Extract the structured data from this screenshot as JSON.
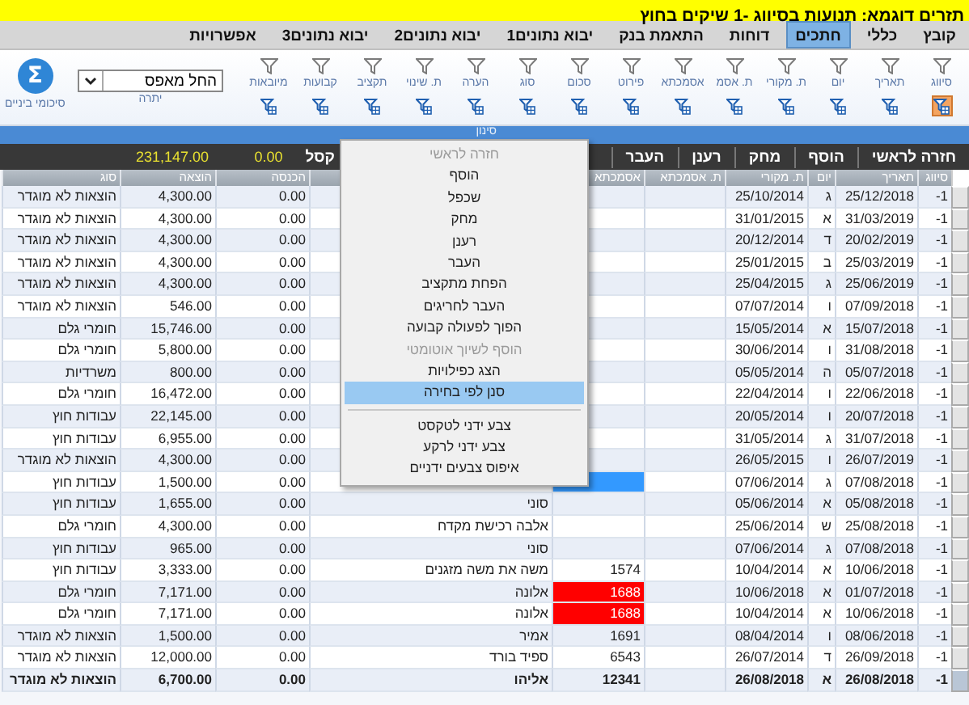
{
  "window": {
    "title": "תזרים דוגמא: תנועות בסיווג -1 שיקים בחוץ"
  },
  "menu_bar": {
    "tabs": [
      {
        "label": "קובץ",
        "selected": false
      },
      {
        "label": "כללי",
        "selected": false
      },
      {
        "label": "חתכים",
        "selected": true
      },
      {
        "label": "דוחות",
        "selected": false
      },
      {
        "label": "התאמת בנק",
        "selected": false
      },
      {
        "label": "יבוא נתונים1",
        "selected": false
      },
      {
        "label": "יבוא נתונים2",
        "selected": false
      },
      {
        "label": "יבוא נתונים3",
        "selected": false
      },
      {
        "label": "אפשרויות",
        "selected": false
      }
    ]
  },
  "toolbar": {
    "filters": [
      {
        "label": "סיווג",
        "active": true
      },
      {
        "label": "תאריך",
        "active": false
      },
      {
        "label": "יום",
        "active": false
      },
      {
        "label": "ת. מקורי",
        "active": false
      },
      {
        "label": "ת. אסמ",
        "active": false
      },
      {
        "label": "אסמכתא",
        "active": false
      },
      {
        "label": "פירוט",
        "active": false
      },
      {
        "label": "סכום",
        "active": false
      },
      {
        "label": "סוג",
        "active": false
      },
      {
        "label": "הערה",
        "active": false
      },
      {
        "label": "ת. שינוי",
        "active": false
      },
      {
        "label": "תקציב",
        "active": false
      },
      {
        "label": "קבועות",
        "active": false
      },
      {
        "label": "מיובאות",
        "active": false
      }
    ],
    "balance": {
      "value": "החל מאפס",
      "label": "יתרה"
    },
    "subtotals": {
      "icon": "Σ",
      "label": "סיכומי ביניים"
    }
  },
  "filter_strip": {
    "label": "סינון"
  },
  "action_bar": {
    "buttons": [
      "חזרה לראשי",
      "הוסף",
      "מחק",
      "רענן",
      "העבר"
    ],
    "export_label": "קסל",
    "income_total": "0.00",
    "expense_total": "231,147.00"
  },
  "table": {
    "columns": [
      "סיווג",
      "תאריך",
      "יום",
      "ת. מקורי",
      "ת. אסמכתא",
      "אסמכתא",
      null,
      "הכנסה",
      "הוצאה",
      "סוג"
    ],
    "rows": [
      {
        "classification": "-1",
        "date": "25/12/2018",
        "day": "ג",
        "original_date": "25/10/2014",
        "income": "0.00",
        "expense": "4,300.00",
        "type": "הוצאות לא מוגדר",
        "selected": false
      },
      {
        "classification": "-1",
        "date": "31/03/2019",
        "day": "א",
        "original_date": "31/01/2015",
        "income": "0.00",
        "expense": "4,300.00",
        "type": "הוצאות לא מוגדר",
        "selected": false
      },
      {
        "classification": "-1",
        "date": "20/02/2019",
        "day": "ד",
        "original_date": "20/12/2014",
        "income": "0.00",
        "expense": "4,300.00",
        "type": "הוצאות לא מוגדר",
        "selected": false
      },
      {
        "classification": "-1",
        "date": "25/03/2019",
        "day": "ב",
        "original_date": "25/01/2015",
        "income": "0.00",
        "expense": "4,300.00",
        "type": "הוצאות לא מוגדר",
        "selected": false
      },
      {
        "classification": "-1",
        "date": "25/06/2019",
        "day": "ג",
        "original_date": "25/04/2015",
        "income": "0.00",
        "expense": "4,300.00",
        "type": "הוצאות לא מוגדר",
        "selected": false
      },
      {
        "classification": "-1",
        "date": "07/09/2018",
        "day": "ו",
        "original_date": "07/07/2014",
        "income": "0.00",
        "expense": "546.00",
        "type": "הוצאות לא מוגדר",
        "selected": false
      },
      {
        "classification": "-1",
        "date": "15/07/2018",
        "day": "א",
        "original_date": "15/05/2014",
        "income": "0.00",
        "expense": "15,746.00",
        "type": "חומרי גלם",
        "selected": false
      },
      {
        "classification": "-1",
        "date": "31/08/2018",
        "day": "ו",
        "original_date": "30/06/2014",
        "income": "0.00",
        "expense": "5,800.00",
        "type": "חומרי גלם",
        "selected": false
      },
      {
        "classification": "-1",
        "date": "05/07/2018",
        "day": "ה",
        "original_date": "05/05/2014",
        "income": "0.00",
        "expense": "800.00",
        "type": "משרדיות",
        "selected": false
      },
      {
        "classification": "-1",
        "date": "22/06/2018",
        "day": "ו",
        "original_date": "22/04/2014",
        "income": "0.00",
        "expense": "16,472.00",
        "type": "חומרי גלם",
        "selected": false
      },
      {
        "classification": "-1",
        "date": "20/07/2018",
        "day": "ו",
        "original_date": "20/05/2014",
        "income": "0.00",
        "expense": "22,145.00",
        "type": "עבודות חוץ",
        "selected": false
      },
      {
        "classification": "-1",
        "date": "31/07/2018",
        "day": "ג",
        "original_date": "31/05/2014",
        "income": "0.00",
        "expense": "6,955.00",
        "type": "עבודות חוץ",
        "selected": false
      },
      {
        "classification": "-1",
        "date": "26/07/2019",
        "day": "ו",
        "original_date": "26/05/2015",
        "income": "0.00",
        "expense": "4,300.00",
        "type": "הוצאות לא מוגדר",
        "selected": false
      },
      {
        "classification": "-1",
        "date": "07/08/2018",
        "day": "ג",
        "original_date": "07/06/2014",
        "color": "#3399ff",
        "income": "0.00",
        "expense": "1,500.00",
        "type": "עבודות חוץ",
        "selected": false
      },
      {
        "classification": "-1",
        "date": "05/08/2018",
        "day": "א",
        "original_date": "05/06/2014",
        "details": "סוני",
        "income": "0.00",
        "expense": "1,655.00",
        "type": "עבודות חוץ",
        "selected": false
      },
      {
        "classification": "-1",
        "date": "25/08/2018",
        "day": "ש",
        "original_date": "25/06/2014",
        "details": "אלבה רכישת מקדח",
        "income": "0.00",
        "expense": "4,300.00",
        "type": "חומרי גלם",
        "selected": false
      },
      {
        "classification": "-1",
        "date": "07/08/2018",
        "day": "ג",
        "original_date": "07/06/2014",
        "details": "סוני",
        "income": "0.00",
        "expense": "965.00",
        "type": "עבודות חוץ",
        "selected": false
      },
      {
        "classification": "-1",
        "date": "10/06/2018",
        "day": "א",
        "original_date": "10/04/2014",
        "reference": "1574",
        "details": "משה את משה מזגנים",
        "income": "0.00",
        "expense": "3,333.00",
        "type": "עבודות חוץ",
        "selected": false
      },
      {
        "classification": "-1",
        "date": "01/07/2018",
        "day": "א",
        "original_date": "10/06/2018",
        "reference": "1688",
        "color": "#ff0000",
        "details": "אלונה",
        "income": "0.00",
        "expense": "7,171.00",
        "type": "חומרי גלם",
        "selected": false
      },
      {
        "classification": "-1",
        "date": "10/06/2018",
        "day": "א",
        "original_date": "10/04/2014",
        "reference": "1688",
        "color": "#ff0000",
        "details": "אלונה",
        "income": "0.00",
        "expense": "7,171.00",
        "type": "חומרי גלם",
        "selected": false
      },
      {
        "classification": "-1",
        "date": "08/06/2018",
        "day": "ו",
        "original_date": "08/04/2014",
        "reference": "1691",
        "details": "אמיר",
        "income": "0.00",
        "expense": "1,500.00",
        "type": "הוצאות לא מוגדר",
        "selected": false
      },
      {
        "classification": "-1",
        "date": "26/09/2018",
        "day": "ד",
        "original_date": "26/07/2014",
        "reference": "6543",
        "details": "ספיד בורד",
        "income": "0.00",
        "expense": "12,000.00",
        "type": "הוצאות לא מוגדר",
        "selected": false
      },
      {
        "classification": "-1",
        "date": "26/08/2018",
        "day": "א",
        "original_date": "26/08/2018",
        "reference": "12341",
        "details": "אליהו",
        "income": "0.00",
        "expense": "6,700.00",
        "type": "הוצאות לא מוגדר",
        "selected": true
      }
    ]
  },
  "context_menu": {
    "items": [
      {
        "kind": "item",
        "label": "חזרה לראשי",
        "disabled": true,
        "selected": false
      },
      {
        "kind": "item",
        "label": "הוסף",
        "disabled": false,
        "selected": false
      },
      {
        "kind": "item",
        "label": "שכפל",
        "disabled": false,
        "selected": false
      },
      {
        "kind": "item",
        "label": "מחק",
        "disabled": false,
        "selected": false
      },
      {
        "kind": "item",
        "label": "רענן",
        "disabled": false,
        "selected": false
      },
      {
        "kind": "item",
        "label": "העבר",
        "disabled": false,
        "selected": false
      },
      {
        "kind": "item",
        "label": "הפחת מתקציב",
        "disabled": false,
        "selected": false
      },
      {
        "kind": "item",
        "label": "העבר לחריגים",
        "disabled": false,
        "selected": false
      },
      {
        "kind": "item",
        "label": "הפוך לפעולה קבועה",
        "disabled": false,
        "selected": false
      },
      {
        "kind": "item",
        "label": "הוסף לשיוך אוטומטי",
        "disabled": true,
        "selected": false
      },
      {
        "kind": "item",
        "label": "הצג כפילויות",
        "disabled": false,
        "selected": false
      },
      {
        "kind": "item",
        "label": "סנן לפי בחירה",
        "disabled": false,
        "selected": true
      },
      {
        "kind": "separator"
      },
      {
        "kind": "item",
        "label": "צבע ידני לטקסט",
        "disabled": false,
        "selected": false
      },
      {
        "kind": "item",
        "label": "צבע ידני לרקע",
        "disabled": false,
        "selected": false
      },
      {
        "kind": "item",
        "label": "איפוס צבעים ידניים",
        "disabled": false,
        "selected": false
      }
    ]
  }
}
